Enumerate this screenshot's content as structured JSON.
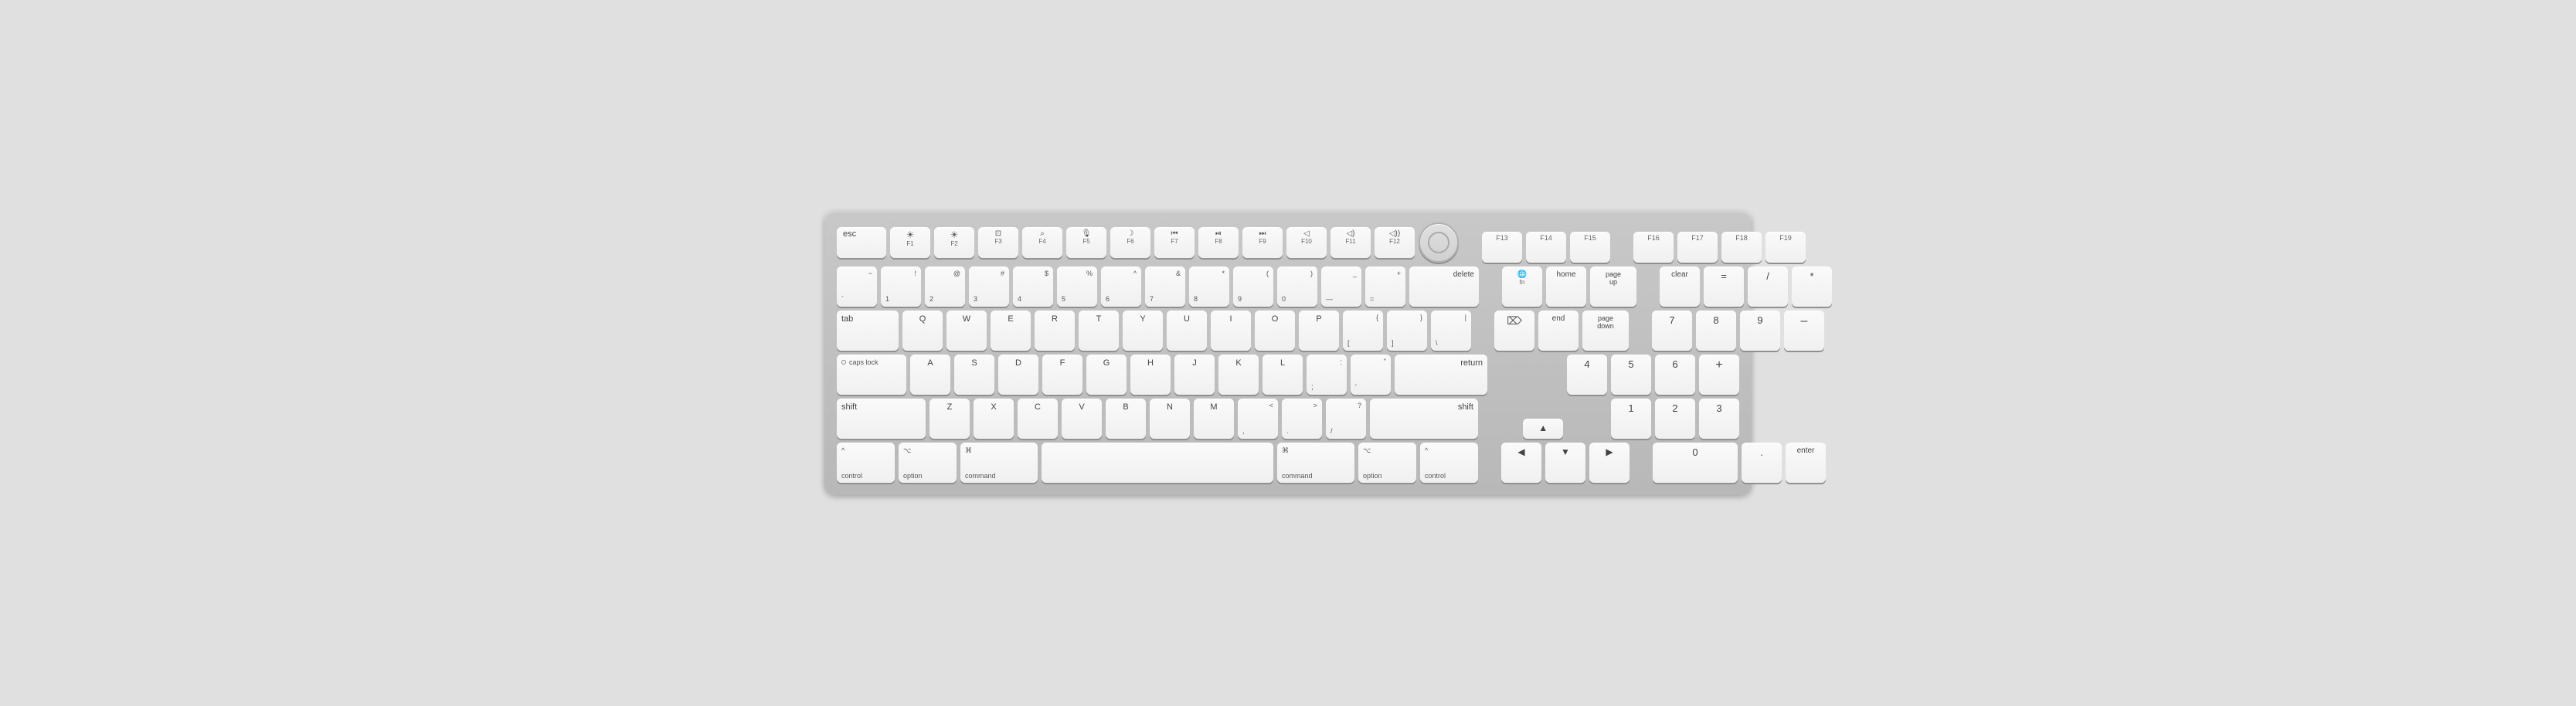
{
  "keyboard": {
    "title": "Apple Magic Keyboard with Numeric Keypad",
    "rows": {
      "fn_row": {
        "keys": [
          {
            "id": "esc",
            "label": "esc",
            "width": 64
          },
          {
            "id": "f1",
            "top": "☀",
            "bottom": "F1",
            "width": 52
          },
          {
            "id": "f2",
            "top": "☀",
            "bottom": "F2",
            "width": 52
          },
          {
            "id": "f3",
            "top": "⊞",
            "bottom": "F3",
            "width": 52
          },
          {
            "id": "f4",
            "top": "🔍",
            "bottom": "F4",
            "width": 52
          },
          {
            "id": "f5",
            "top": "🎤",
            "bottom": "F5",
            "width": 52
          },
          {
            "id": "f6",
            "top": "☾",
            "bottom": "F6",
            "width": 52
          },
          {
            "id": "f7",
            "top": "⏮",
            "bottom": "F7",
            "width": 52
          },
          {
            "id": "f8",
            "top": "⏯",
            "bottom": "F8",
            "width": 52
          },
          {
            "id": "f9",
            "top": "⏭",
            "bottom": "F9",
            "width": 52
          },
          {
            "id": "f10",
            "top": "🔇",
            "bottom": "F10",
            "width": 52
          },
          {
            "id": "f11",
            "top": "🔈",
            "bottom": "F11",
            "width": 52
          },
          {
            "id": "f12",
            "top": "🔊",
            "bottom": "F12",
            "width": 52
          },
          {
            "id": "power",
            "type": "power",
            "width": 52
          }
        ]
      },
      "number_row": {
        "keys": [
          {
            "id": "grave",
            "top": "~",
            "bottom": "`",
            "width": 52
          },
          {
            "id": "1",
            "top": "!",
            "bottom": "1",
            "width": 52
          },
          {
            "id": "2",
            "top": "@",
            "bottom": "2",
            "width": 52
          },
          {
            "id": "3",
            "top": "#",
            "bottom": "3",
            "width": 52
          },
          {
            "id": "4",
            "top": "$",
            "bottom": "4",
            "width": 52
          },
          {
            "id": "5",
            "top": "%",
            "bottom": "5",
            "width": 52
          },
          {
            "id": "6",
            "top": "^",
            "bottom": "6",
            "width": 52
          },
          {
            "id": "7",
            "top": "&",
            "bottom": "7",
            "width": 52
          },
          {
            "id": "8",
            "top": "*",
            "bottom": "8",
            "width": 52
          },
          {
            "id": "9",
            "top": "(",
            "bottom": "9",
            "width": 52
          },
          {
            "id": "0",
            "top": ")",
            "bottom": "0",
            "width": 52
          },
          {
            "id": "minus",
            "top": "_",
            "bottom": "—",
            "width": 52
          },
          {
            "id": "equals",
            "top": "+",
            "bottom": "=",
            "width": 52
          },
          {
            "id": "delete",
            "label": "delete",
            "width": 90
          }
        ]
      }
    }
  }
}
